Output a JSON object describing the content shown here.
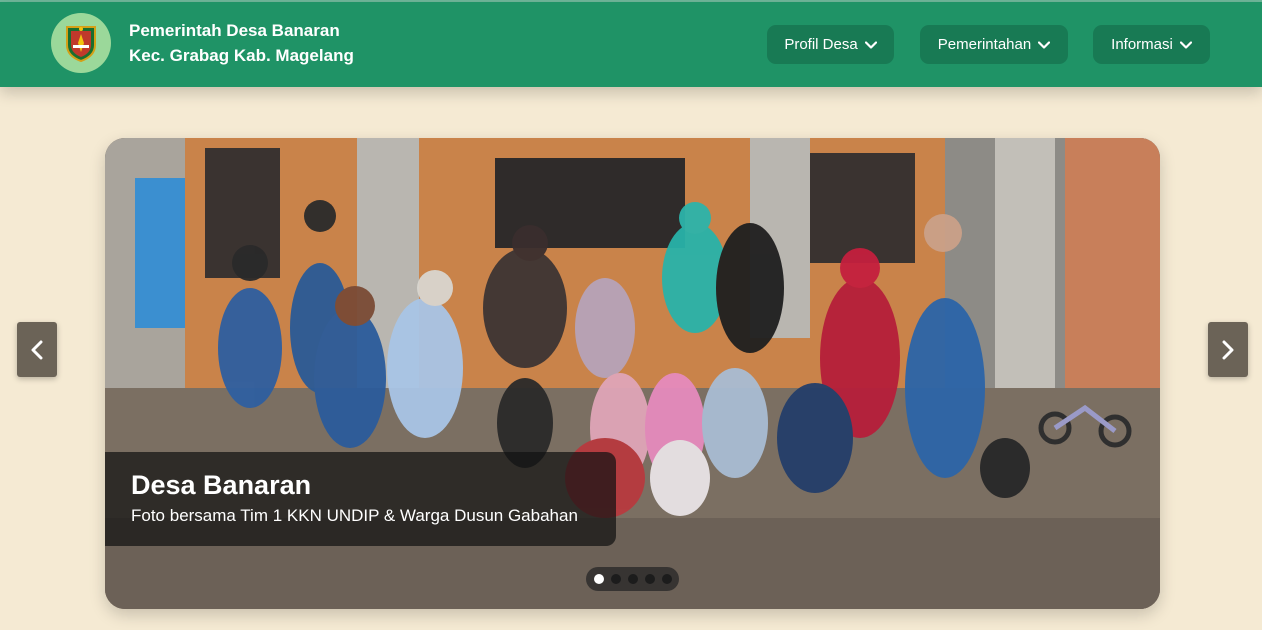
{
  "header": {
    "line1": "Pemerintah Desa Banaran",
    "line2": "Kec. Grabag Kab. Magelang",
    "logo_icon": "village-emblem-icon"
  },
  "nav": [
    {
      "label": "Profil Desa",
      "icon": "chevron-down-icon"
    },
    {
      "label": "Pemerintahan",
      "icon": "chevron-down-icon"
    },
    {
      "label": "Informasi",
      "icon": "chevron-down-icon"
    }
  ],
  "slider": {
    "title": "Desa Banaran",
    "subtitle": "Foto bersama Tim 1 KKN UNDIP & Warga Dusun Gabahan",
    "active_index": 0,
    "slide_count": 5,
    "prev_icon": "chevron-left-icon",
    "next_icon": "chevron-right-icon"
  },
  "colors": {
    "header_bg": "#1f9366",
    "nav_button_bg": "#187a54",
    "page_bg": "#f5ead3"
  }
}
